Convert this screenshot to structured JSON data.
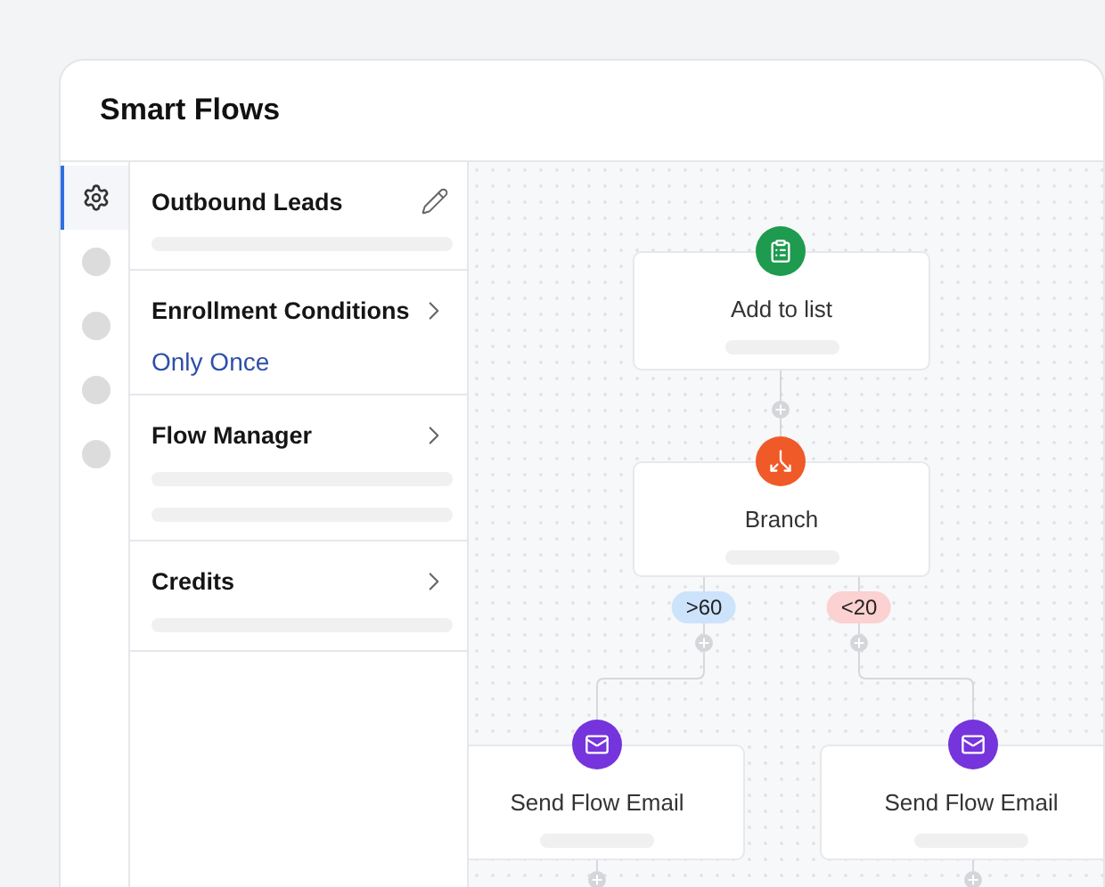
{
  "window": {
    "title": "Smart Flows"
  },
  "rail": {
    "items": [
      {
        "kind": "settings",
        "selected": true
      },
      {
        "kind": "placeholder",
        "selected": false
      },
      {
        "kind": "placeholder",
        "selected": false
      },
      {
        "kind": "placeholder",
        "selected": false
      },
      {
        "kind": "placeholder",
        "selected": false
      }
    ]
  },
  "sections": [
    {
      "title": "Outbound Leads",
      "kind": "editable"
    },
    {
      "title": "Enrollment Conditions",
      "kind": "condition",
      "value": "Only Once"
    },
    {
      "title": "Flow Manager",
      "kind": "detail"
    },
    {
      "title": "Credits",
      "kind": "summary"
    }
  ],
  "canvas": {
    "nodes": [
      {
        "label": "Add to list",
        "kind": "list",
        "color": "#1e9b4f"
      },
      {
        "label": "Branch",
        "kind": "branch",
        "color": "#f05a28"
      },
      {
        "label": "Send Flow Email",
        "kind": "email",
        "color": "#7534dc"
      },
      {
        "label": "Send Flow Email",
        "kind": "email",
        "color": "#7534dc"
      }
    ],
    "branches": [
      {
        "label": ">60",
        "color": "#cde3fb"
      },
      {
        "label": "<20",
        "color": "#fbd1d1"
      }
    ]
  }
}
